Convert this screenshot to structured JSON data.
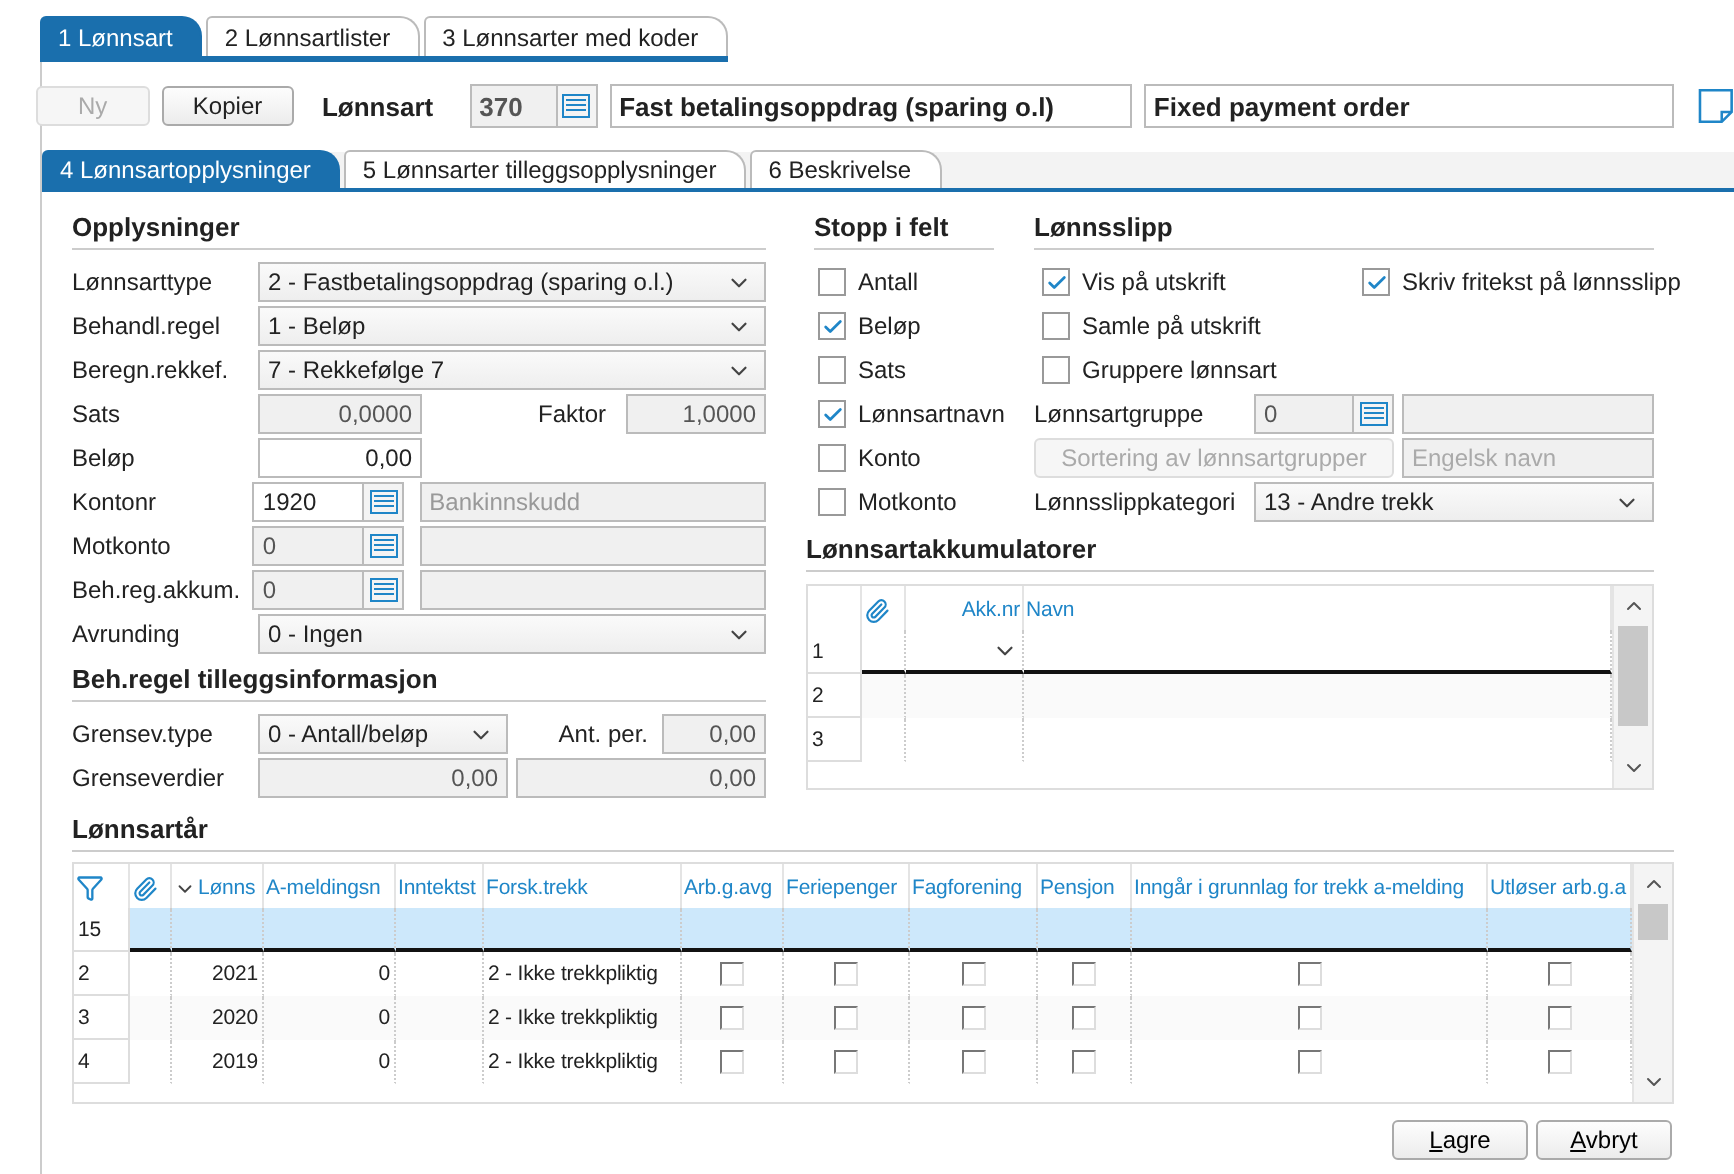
{
  "top_tabs": [
    {
      "label": "1 Lønnsart",
      "selected": true
    },
    {
      "label": "2 Lønnsartlister",
      "selected": false
    },
    {
      "label": "3 Lønnsarter med koder",
      "selected": false
    }
  ],
  "toolbar": {
    "buttons": [
      {
        "label": "Ny",
        "disabled": true
      },
      {
        "label": "Kopier",
        "disabled": false
      }
    ],
    "field_label": "Lønnsart",
    "code": "370",
    "name": "Fast betalingsoppdrag (sparing o.l)",
    "english_name": "Fixed payment order"
  },
  "sub_tabs": [
    {
      "label": "4 Lønnsartopplysninger",
      "selected": true
    },
    {
      "label": "5 Lønnsarter tilleggsopplysninger",
      "selected": false
    },
    {
      "label": "6 Beskrivelse",
      "selected": false
    }
  ],
  "opplysninger": {
    "title": "Opplysninger",
    "rows": [
      {
        "kind": "select",
        "label": "Lønnsarttype",
        "value": "2 - Fastbetalingsoppdrag (sparing o.l.)"
      },
      {
        "kind": "select",
        "label": "Behandl.regel",
        "value": "1 - Beløp"
      },
      {
        "kind": "select",
        "label": "Beregn.rekkef.",
        "value": "7 - Rekkefølge 7"
      },
      {
        "kind": "pair",
        "label": "Sats",
        "value": "0,0000",
        "disabled": true,
        "label2": "Faktor",
        "value2": "1,0000"
      },
      {
        "kind": "number",
        "label": "Beløp",
        "value": "0,00",
        "disabled": false
      },
      {
        "kind": "lookup",
        "label": "Kontonr",
        "value": "1920",
        "disabled": false,
        "description": "Bankinnskudd"
      },
      {
        "kind": "lookup",
        "label": "Motkonto",
        "value": "0",
        "disabled": true
      },
      {
        "kind": "lookup",
        "label": "Beh.reg.akkum.",
        "value": "0",
        "disabled": true
      },
      {
        "kind": "select",
        "label": "Avrunding",
        "value": "0 - Ingen"
      }
    ]
  },
  "tillegg": {
    "title": "Beh.regel tilleggsinformasjon",
    "type_label": "Grensev.type",
    "type_value": "0 - Antall/beløp",
    "per_label": "Ant. per.",
    "per_value": "0,00",
    "limits_label": "Grenseverdier",
    "limits": [
      "0,00",
      "0,00"
    ]
  },
  "stopp": {
    "title": "Stopp i felt",
    "items": [
      {
        "label": "Antall",
        "checked": false
      },
      {
        "label": "Beløp",
        "checked": true
      },
      {
        "label": "Sats",
        "checked": false
      },
      {
        "label": "Lønnsartnavn",
        "checked": true
      },
      {
        "label": "Konto",
        "checked": false
      },
      {
        "label": "Motkonto",
        "checked": false
      }
    ]
  },
  "lonnsslipp": {
    "title": "Lønnsslipp",
    "checks": [
      {
        "label": "Vis på utskrift",
        "checked": true
      },
      {
        "label": "Skriv fritekst på lønnsslipp",
        "checked": true
      },
      {
        "label": "Samle på utskrift",
        "checked": false
      },
      {
        "label": "Gruppere lønnsart",
        "checked": false
      }
    ],
    "group_label": "Lønnsartgruppe",
    "group_value": "0",
    "sort_button": "Sortering av lønnsartgrupper",
    "english_placeholder": "Engelsk navn",
    "category_label": "Lønnsslippkategori",
    "category_value": "13 - Andre trekk"
  },
  "akkumulatorer": {
    "title": "Lønnsartakkumulatorer",
    "columns": [
      "Akk.nr",
      "Navn"
    ],
    "rows": [
      {
        "number": "1",
        "selected": true
      },
      {
        "number": "2",
        "selected": false
      },
      {
        "number": "3",
        "selected": false
      }
    ]
  },
  "lonnsartar": {
    "title": "Lønnsartår",
    "columns": [
      "Lønns",
      "A-meldingsn",
      "Inntektst",
      "Forsk.trekk",
      "Arb.g.avg",
      "Feriepenger",
      "Fagforening",
      "Pensjon",
      "Inngår i grunnlag for trekk a-melding",
      "Utløser arb.g.a"
    ],
    "rows": [
      {
        "number": "15",
        "selected": true
      },
      {
        "number": "2",
        "selected": false,
        "year": "2021",
        "a_melding": "0",
        "forsk_trekk": "2 - Ikke trekkpliktig",
        "checks": [
          false,
          false,
          false,
          false,
          false,
          false
        ]
      },
      {
        "number": "3",
        "selected": false,
        "year": "2020",
        "a_melding": "0",
        "forsk_trekk": "2 - Ikke trekkpliktig",
        "checks": [
          false,
          false,
          false,
          false,
          false,
          false
        ]
      },
      {
        "number": "4",
        "selected": false,
        "year": "2019",
        "a_melding": "0",
        "forsk_trekk": "2 - Ikke trekkpliktig",
        "checks": [
          false,
          false,
          false,
          false,
          false,
          false
        ]
      }
    ]
  },
  "buttons": [
    "Lagre",
    "Avbryt"
  ]
}
